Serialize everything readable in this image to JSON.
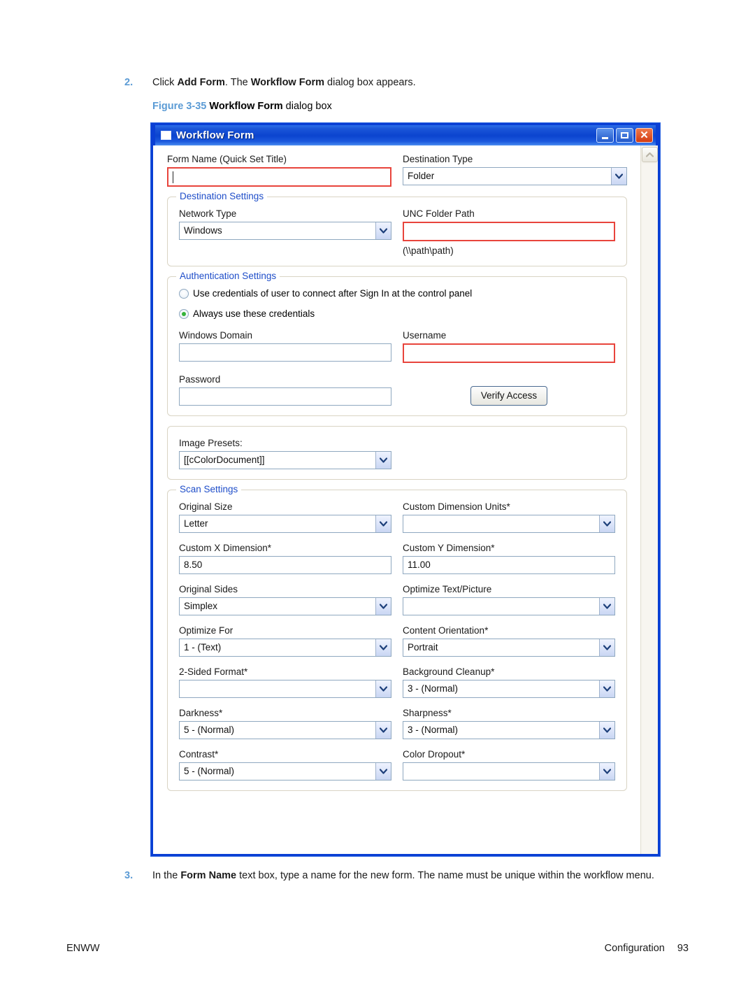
{
  "document": {
    "step2": {
      "number": "2.",
      "pre": "Click ",
      "bold1": "Add Form",
      "mid": ". The ",
      "bold2": "Workflow Form",
      "post": " dialog box appears."
    },
    "figure": {
      "label": "Figure 3-35",
      "bold": "Workflow Form",
      "rest": " dialog box"
    },
    "step3": {
      "number": "3.",
      "pre": "In the ",
      "bold1": "Form Name",
      "post": " text box, type a name for the new form. The name must be unique within the workflow menu."
    },
    "footer": {
      "left": "ENWW",
      "section": "Configuration",
      "page": "93"
    }
  },
  "dialog": {
    "title": "Workflow Form",
    "titlebar_buttons": {
      "minimize": "minimize",
      "maximize": "maximize",
      "close": "close"
    },
    "top": {
      "form_name_label": "Form Name (Quick Set Title)",
      "form_name_value": "",
      "destination_type_label": "Destination Type",
      "destination_type_value": "Folder"
    },
    "destination_settings": {
      "legend": "Destination Settings",
      "network_type_label": "Network Type",
      "network_type_value": "Windows",
      "unc_folder_path_label": "UNC Folder Path",
      "unc_folder_path_value": "",
      "unc_hint": "(\\\\path\\path)"
    },
    "authentication_settings": {
      "legend": "Authentication Settings",
      "radio1_label": "Use credentials of user to connect after Sign In at the control panel",
      "radio2_label": "Always use these credentials",
      "selected_radio": 2,
      "windows_domain_label": "Windows Domain",
      "windows_domain_value": "",
      "username_label": "Username",
      "username_value": "",
      "password_label": "Password",
      "password_value": "",
      "verify_access_button": "Verify Access"
    },
    "image_presets": {
      "label": "Image Presets:",
      "value": "[[cColorDocument]]"
    },
    "scan_settings": {
      "legend": "Scan Settings",
      "fields": [
        {
          "label": "Original Size",
          "value": "Letter",
          "type": "combo"
        },
        {
          "label": "Custom Dimension Units*",
          "value": "",
          "type": "combo"
        },
        {
          "label": "Custom X Dimension*",
          "value": "8.50",
          "type": "text"
        },
        {
          "label": "Custom Y Dimension*",
          "value": "11.00",
          "type": "text"
        },
        {
          "label": "Original Sides",
          "value": "Simplex",
          "type": "combo"
        },
        {
          "label": "Optimize Text/Picture",
          "value": "",
          "type": "combo"
        },
        {
          "label": "Optimize For",
          "value": "1 - (Text)",
          "type": "combo"
        },
        {
          "label": "Content Orientation*",
          "value": "Portrait",
          "type": "combo"
        },
        {
          "label": "2-Sided Format*",
          "value": "",
          "type": "combo"
        },
        {
          "label": "Background Cleanup*",
          "value": "3 - (Normal)",
          "type": "combo"
        },
        {
          "label": "Darkness*",
          "value": "5 - (Normal)",
          "type": "combo"
        },
        {
          "label": "Sharpness*",
          "value": "3 - (Normal)",
          "type": "combo"
        },
        {
          "label": "Contrast*",
          "value": "5 - (Normal)",
          "type": "combo"
        },
        {
          "label": "Color Dropout*",
          "value": "",
          "type": "combo"
        }
      ]
    },
    "scrollbar": {
      "up_arrow": "scroll-up"
    }
  },
  "colors": {
    "accent_blue": "#5b9bd5",
    "titlebar_blue": "#0b44cf",
    "legend_blue": "#1f4ec9",
    "error_red": "#e8443c",
    "radio_green": "#35b33a"
  }
}
